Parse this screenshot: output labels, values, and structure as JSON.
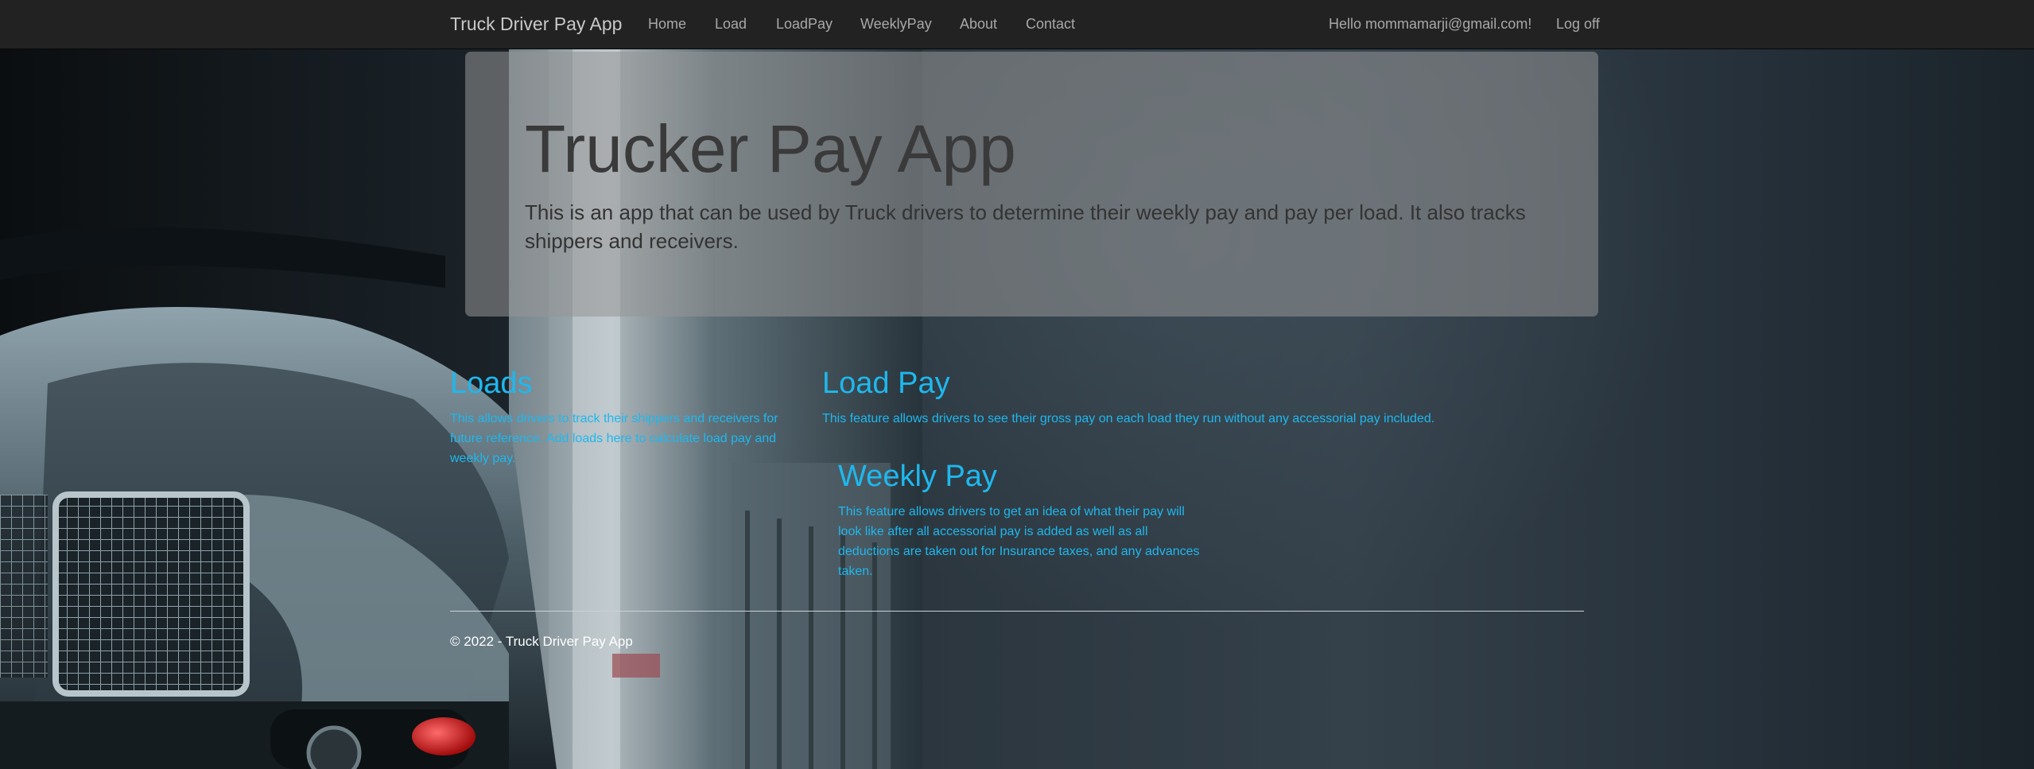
{
  "navbar": {
    "brand": "Truck Driver Pay App",
    "links": [
      "Home",
      "Load",
      "LoadPay",
      "WeeklyPay",
      "About",
      "Contact"
    ],
    "greeting": "Hello mommamarji@gmail.com!",
    "logoff": "Log off"
  },
  "jumbotron": {
    "title": "Trucker Pay App",
    "lead": "This is an app that can be used by Truck drivers to determine their weekly pay and pay per load. It also tracks shippers and receivers."
  },
  "sections": {
    "loads": {
      "title": "Loads",
      "text": "This allows drivers to track their shippers and receivers for future reference. Add loads here to calculate load pay and weekly pay."
    },
    "load_pay": {
      "title": "Load Pay",
      "text": "This feature allows drivers to see their gross pay on each load they run without any accessorial pay included."
    },
    "weekly_pay": {
      "title": "Weekly Pay",
      "text": "This feature allows drivers to get an idea of what their pay will look like after all accessorial pay is added as well as all deductions are taken out for Insurance taxes, and any advances taken."
    }
  },
  "footer": {
    "text": "© 2022 - Truck Driver Pay App"
  },
  "colors": {
    "navbar_bg": "#222222",
    "accent": "#1eb8ee",
    "jumbotron_bg": "rgba(150,150,150,0.55)"
  },
  "background_image": "truck-photo"
}
